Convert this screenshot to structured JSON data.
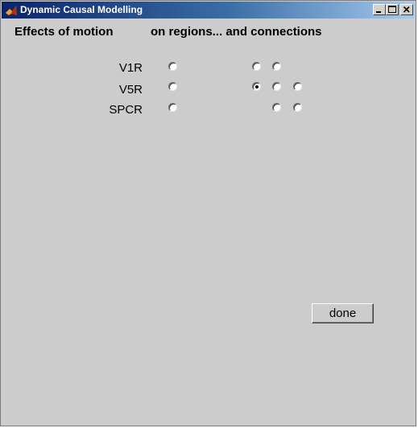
{
  "window": {
    "title": "Dynamic Causal Modelling",
    "icon": "matlab-icon",
    "controls": [
      "minimize-icon",
      "maximize-icon",
      "close-icon"
    ]
  },
  "headings": {
    "effects": "Effects of motion",
    "regions_connections": "on regions... and connections"
  },
  "regions": [
    {
      "label": "V1R",
      "region_selected": false,
      "connections": [
        false,
        false
      ]
    },
    {
      "label": "V5R",
      "region_selected": false,
      "connections": [
        true,
        false,
        false
      ]
    },
    {
      "label": "SPCR",
      "region_selected": false,
      "connections": [
        false,
        false
      ]
    }
  ],
  "done_label": "done",
  "colors": {
    "background": "#cccccc",
    "titlebar_start": "#0a246a",
    "titlebar_end": "#a6caf0"
  }
}
